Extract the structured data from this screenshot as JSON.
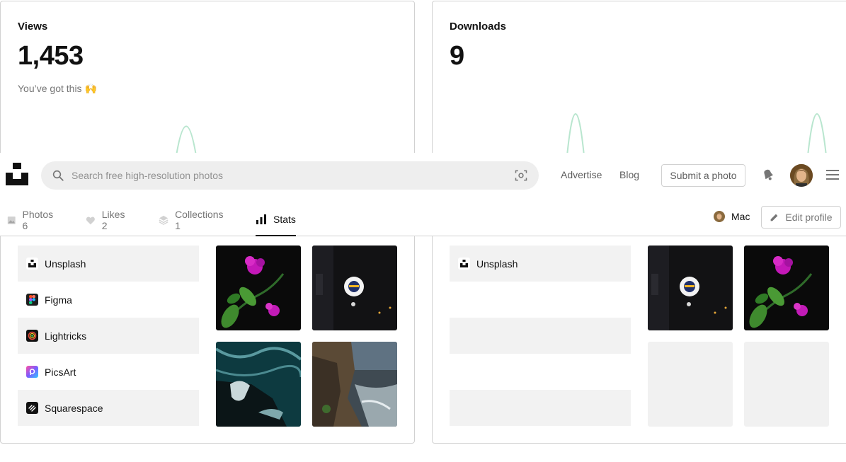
{
  "views_card": {
    "title": "Views",
    "value": "1,453",
    "subtitle": "You’ve got this 🙌"
  },
  "downloads_card": {
    "title": "Downloads",
    "value": "9"
  },
  "views_apps": [
    "Unsplash",
    "Figma",
    "Lightricks",
    "PicsArt",
    "Squarespace"
  ],
  "downloads_apps": [
    "Unsplash"
  ],
  "header": {
    "search_placeholder": "Search free high-resolution photos",
    "advertise": "Advertise",
    "blog": "Blog",
    "submit": "Submit a photo"
  },
  "tabs": {
    "photos": "Photos 6",
    "likes": "Likes 2",
    "collections": "Collections 1",
    "stats": "Stats"
  },
  "profile": {
    "name": "Mac",
    "edit": "Edit profile"
  },
  "colors": {
    "spark": "#b9e6cf",
    "accent_shade": "#f2f2f2"
  }
}
